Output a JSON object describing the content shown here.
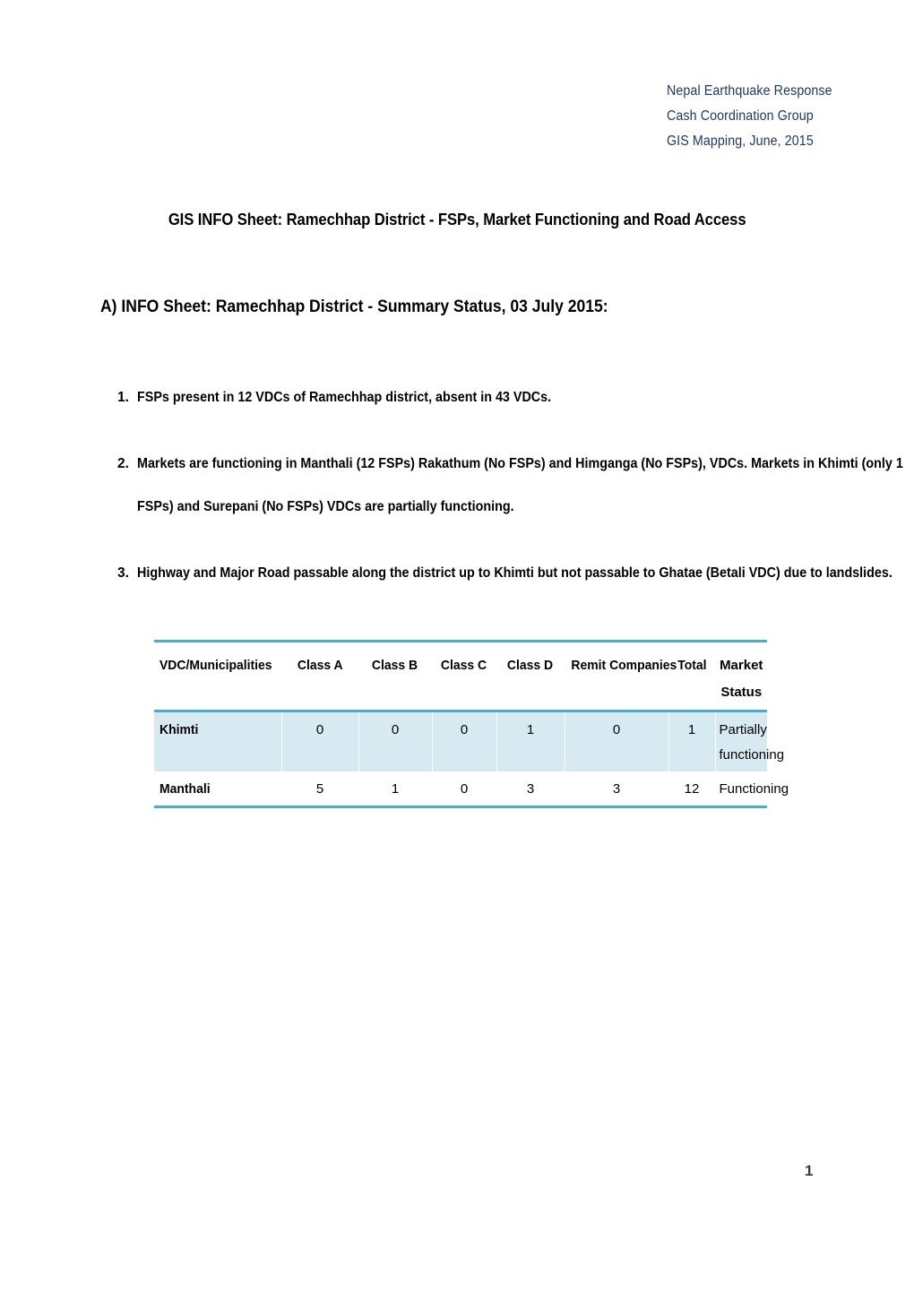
{
  "document": {
    "header_lines": [
      "Nepal Earthquake Response",
      "Cash Coordination Group",
      "GIS Mapping, June, 2015"
    ],
    "header_color": "#1F3864",
    "title": "GIS INFO Sheet: Ramechhap District - FSPs, Market Functioning and Road Access",
    "section_a_heading": "A) INFO Sheet: Ramechhap District - Summary Status, 03 July 2015:",
    "page_number": "1"
  },
  "findings": [
    {
      "number": "1.",
      "lines": [
        "FSPs present in 12 VDCs of Ramechhap district, absent in 43 VDCs."
      ]
    },
    {
      "number": "2.",
      "lines": [
        "Markets are functioning in Manthali (12 FSPs) Rakathum (No FSPs) and Himganga (No FSPs), VDCs. Markets in Khimti (only 1",
        "FSPs) and Surepani (No FSPs) VDCs are partially functioning."
      ]
    },
    {
      "number": "3.",
      "lines": [
        "Highway and Major Road passable along the district up to Khimti but not passable to Ghatae (Betali VDC) due to landslides."
      ]
    }
  ],
  "table": {
    "accent_color": "#4BACC6",
    "shaded_row_color": "#D7EAF2",
    "columns": [
      "VDC/Municipalities",
      "Class A",
      "Class B",
      "Class C",
      "Class D",
      "Remit Companies",
      "Total",
      "Market Status"
    ],
    "rows": [
      {
        "name": "Khimti",
        "class_a": "0",
        "class_b": "0",
        "class_c": "0",
        "class_d": "1",
        "remit": "0",
        "total": "1",
        "status": "Partially functioning",
        "shaded": true
      },
      {
        "name": "Manthali",
        "class_a": "5",
        "class_b": "1",
        "class_c": "0",
        "class_d": "3",
        "remit": "3",
        "total": "12",
        "status": "Functioning",
        "shaded": false
      }
    ]
  }
}
